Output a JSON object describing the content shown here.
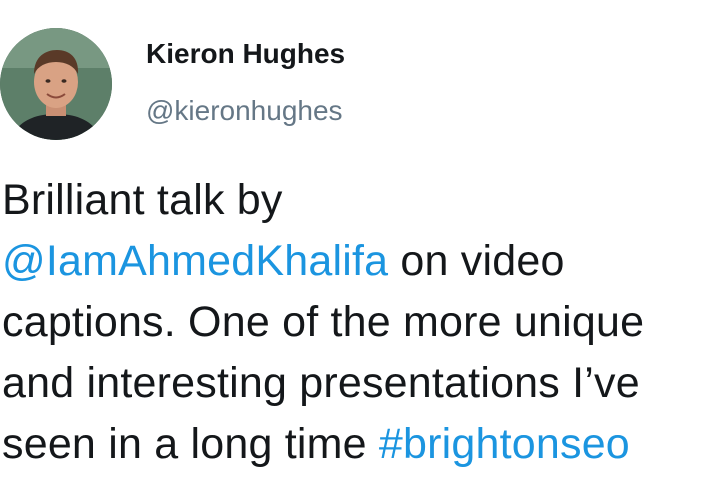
{
  "author": {
    "display_name": "Kieron Hughes",
    "handle": "@kieronhughes"
  },
  "tweet": {
    "line1": "Brilliant talk by",
    "mention": "@IamAhmedKhalifa",
    "line2_rest": " on video",
    "line3": "captions. One of the more unique",
    "line4": "and interesting presentations I’ve",
    "line5_start": "seen in a long time ",
    "hashtag": "#brightonseo"
  },
  "colors": {
    "link": "#1b95e0",
    "text": "#14171a",
    "handle": "#657786"
  }
}
